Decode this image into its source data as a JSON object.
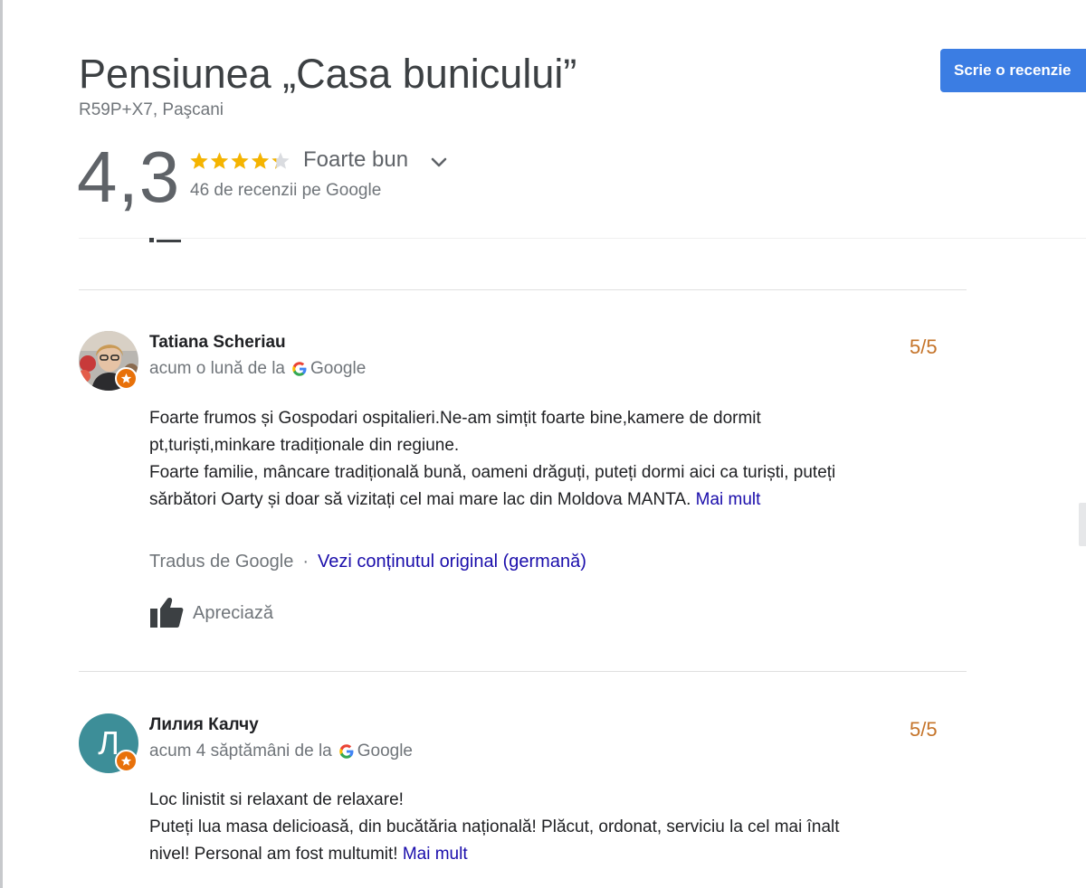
{
  "place": {
    "name": "Pensiunea „Casa bunicului”",
    "address": "R59P+X7, Paşcani",
    "rating": "4,3",
    "rating_label": "Foarte bun",
    "reviews_count": "46 de recenzii pe Google",
    "star_fraction": 0.86
  },
  "toolbar": {
    "write_review": "Scrie o recenzie"
  },
  "colors": {
    "accent": "#3b7de3",
    "score": "#c5742a",
    "star": "#f5b400",
    "link": "#1a0dab"
  },
  "reviews": [
    {
      "name": "Tatiana Scheriau",
      "time": "acum o lună de la",
      "source": "Google",
      "score": "5/5",
      "text_line1": "Foarte frumos și Gospodari ospitalieri.Ne-am simțit foarte bine,kamere de dormit",
      "text_line2": "pt,turiști,minkare tradiționale din regiune.",
      "text_line3": "Foarte familie, mâncare tradițională bună, oameni drăguți, puteți dormi aici ca turiști, puteți",
      "text_line4": "sărbători Oarty și doar să vizitați cel mai mare lac din Moldova MANTA.",
      "more": "Mai mult",
      "translated_by": "Tradus de Google",
      "view_original": "Vezi conținutul original (germană)",
      "like": "Apreciază"
    },
    {
      "name": "Лилия Калчу",
      "avatar_letter": "Л",
      "time": "acum 4 săptămâni de la",
      "source": "Google",
      "score": "5/5",
      "text_line1": "Loc linistit si relaxant de relaxare!",
      "text_line2": "Puteți lua masa delicioasă, din bucătăria națională! Plăcut, ordonat, serviciu la cel mai înalt",
      "text_line3": "nivel! Personal am fost multumit!",
      "more": "Mai mult"
    }
  ]
}
